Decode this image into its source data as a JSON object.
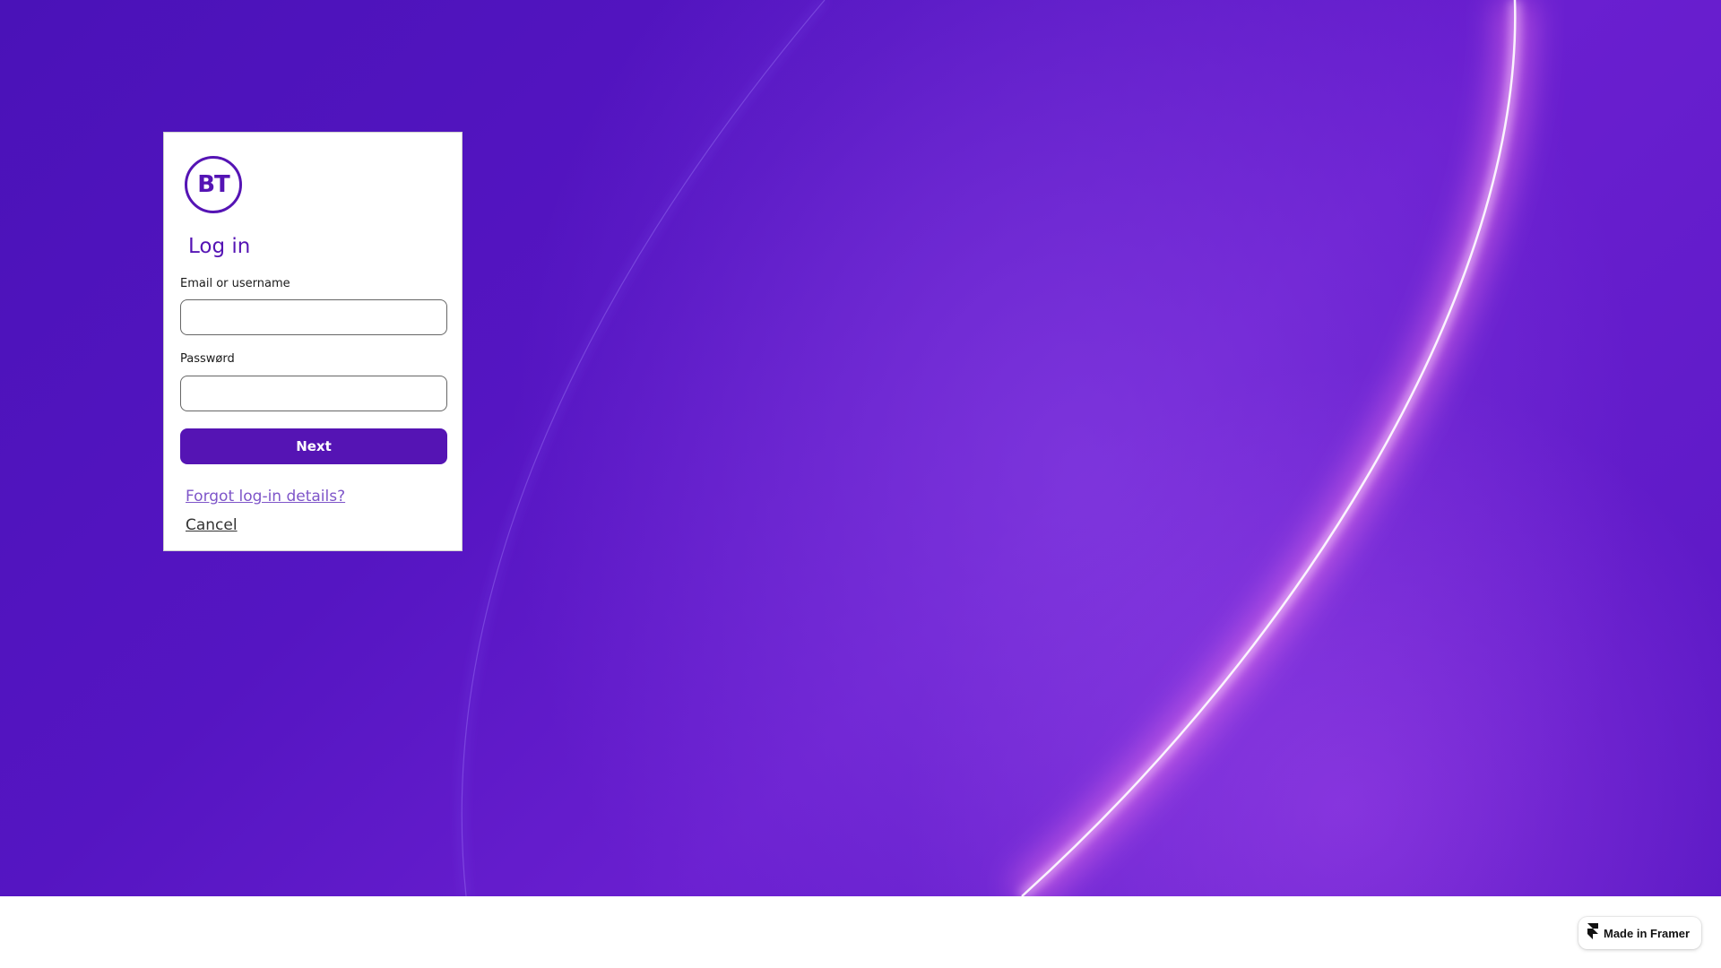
{
  "logo": {
    "text": "BT",
    "color": "#5514b4"
  },
  "login": {
    "title": "Log in",
    "email_label": "Email or username",
    "email_value": "",
    "password_label": "Passwørd",
    "password_value": "",
    "next_label": "Next",
    "forgot_label": "Forgot log-in details?",
    "cancel_label": "Cancel"
  },
  "badge": {
    "label": "Made in Framer",
    "icon": "framer-icon"
  },
  "colors": {
    "brand": "#5514b4",
    "background": "#5a18c4",
    "link": "#7e55c9"
  }
}
